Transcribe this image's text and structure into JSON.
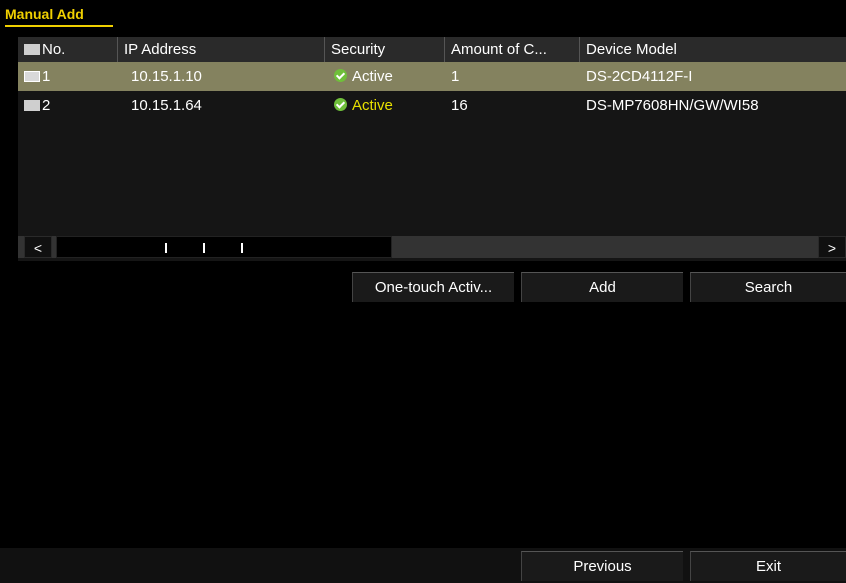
{
  "tab": {
    "label": "Manual Add"
  },
  "table": {
    "headers": {
      "no": "No.",
      "ip": "IP Address",
      "security": "Security",
      "amount": "Amount of C...",
      "model": "Device Model"
    },
    "rows": [
      {
        "no": "1",
        "ip": "10.15.1.10",
        "security": "Active",
        "amount": "1",
        "model": "DS-2CD4112F-I"
      },
      {
        "no": "2",
        "ip": "10.15.1.64",
        "security": "Active",
        "amount": "16",
        "model": "DS-MP7608HN/GW/WI58"
      }
    ]
  },
  "scroll": {
    "left": "<",
    "right": ">"
  },
  "buttons": {
    "one_touch": "One-touch Activ...",
    "add": "Add",
    "search": "Search",
    "previous": "Previous",
    "exit": "Exit"
  },
  "colors": {
    "accent": "#f0d000",
    "selected_row": "#84825f",
    "active": "#e8e000"
  }
}
